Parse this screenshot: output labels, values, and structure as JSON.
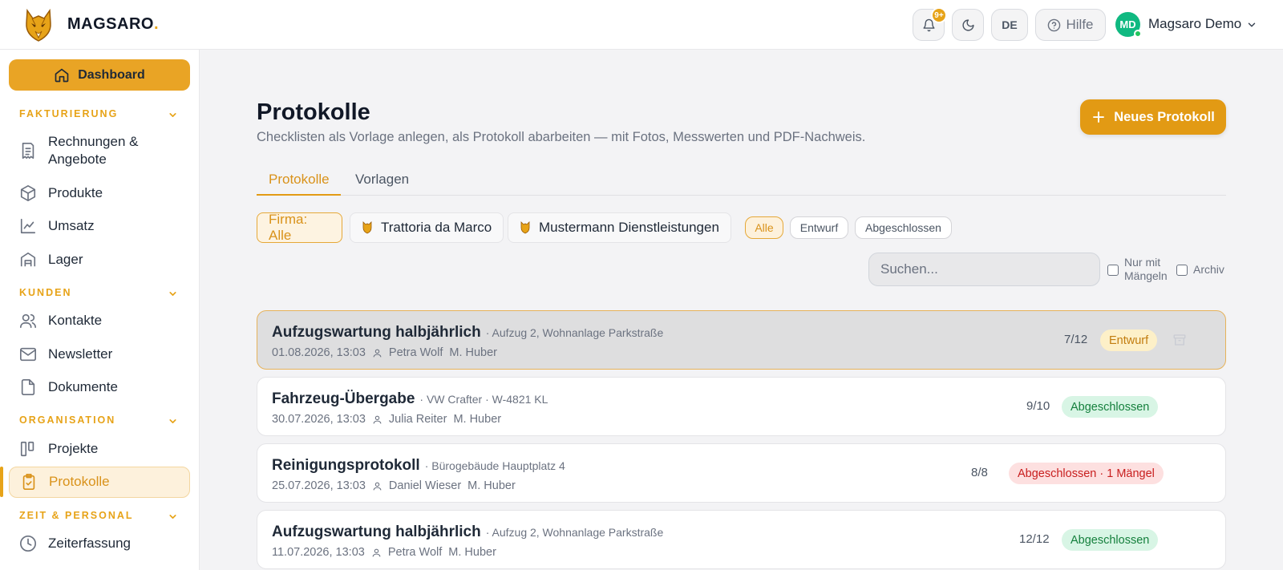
{
  "header": {
    "brand_name": "MAGSARO",
    "brand_dot": ".",
    "notification_badge": "9+",
    "language": "DE",
    "help_label": "Hilfe",
    "avatar_initials": "MD",
    "user_name": "Magsaro Demo"
  },
  "sidebar": {
    "dashboard": "Dashboard",
    "sections": [
      {
        "title": "FAKTURIERUNG",
        "items": [
          {
            "label": "Rechnungen &",
            "label2": "Angebote",
            "icon": "receipt-icon"
          },
          {
            "label": "Produkte",
            "icon": "box-icon"
          },
          {
            "label": "Umsatz",
            "icon": "chart-icon"
          },
          {
            "label": "Lager",
            "icon": "warehouse-icon"
          }
        ]
      },
      {
        "title": "KUNDEN",
        "items": [
          {
            "label": "Kontakte",
            "icon": "users-icon"
          },
          {
            "label": "Newsletter",
            "icon": "mail-icon"
          },
          {
            "label": "Dokumente",
            "icon": "document-icon"
          }
        ]
      },
      {
        "title": "ORGANISATION",
        "items": [
          {
            "label": "Projekte",
            "icon": "kanban-icon"
          },
          {
            "label": "Protokolle",
            "icon": "clipboard-check-icon",
            "active": true
          }
        ]
      },
      {
        "title": "ZEIT & PERSONAL",
        "items": [
          {
            "label": "Zeiterfassung",
            "icon": "clock-icon"
          }
        ]
      }
    ]
  },
  "page": {
    "title": "Protokolle",
    "subtitle": "Checklisten als Vorlage anlegen, als Protokoll abarbeiten — mit Fotos, Messwerten und PDF-Nachweis.",
    "new_button": "Neues Protokoll",
    "tabs": [
      {
        "label": "Protokolle",
        "active": true
      },
      {
        "label": "Vorlagen",
        "active": false
      }
    ],
    "company_filter": {
      "label": "Firma: Alle",
      "companies": [
        "Trattoria da Marco",
        "Mustermann Dienstleistungen"
      ]
    },
    "status_filters": [
      {
        "label": "Alle",
        "active": true
      },
      {
        "label": "Entwurf"
      },
      {
        "label": "Abgeschlossen"
      }
    ],
    "search_placeholder": "Suchen...",
    "checkbox_defects": {
      "line1": "Nur mit",
      "line2": "Mängeln"
    },
    "checkbox_archive": "Archiv"
  },
  "protocols": [
    {
      "title": "Aufzugswartung halbjährlich",
      "subject": "· Aufzug 2, Wohnanlage Parkstraße",
      "date": "01.08.2026, 13:03",
      "person": "Petra Wolf",
      "supervisor": "M. Huber",
      "count": "7/12",
      "status": "Entwurf",
      "status_type": "draft"
    },
    {
      "title": "Fahrzeug-Übergabe",
      "subject": "· VW Crafter · W-4821 KL",
      "date": "30.07.2026, 13:03",
      "person": "Julia Reiter",
      "supervisor": "M. Huber",
      "count": "9/10",
      "status": "Abgeschlossen",
      "status_type": "done"
    },
    {
      "title": "Reinigungsprotokoll",
      "subject": "· Bürogebäude Hauptplatz 4",
      "date": "25.07.2026, 13:03",
      "person": "Daniel Wieser",
      "supervisor": "M. Huber",
      "count": "8/8",
      "status": "Abgeschlossen · 1 Mängel",
      "status_type": "defect"
    },
    {
      "title": "Aufzugswartung halbjährlich",
      "subject": "· Aufzug 2, Wohnanlage Parkstraße",
      "date": "11.07.2026, 13:03",
      "person": "Petra Wolf",
      "supervisor": "M. Huber",
      "count": "12/12",
      "status": "Abgeschlossen",
      "status_type": "done"
    }
  ],
  "colors": {
    "accent": "#e29a14",
    "draft": "#c27c0e",
    "done": "#15803d",
    "defect": "#c81e1e"
  }
}
